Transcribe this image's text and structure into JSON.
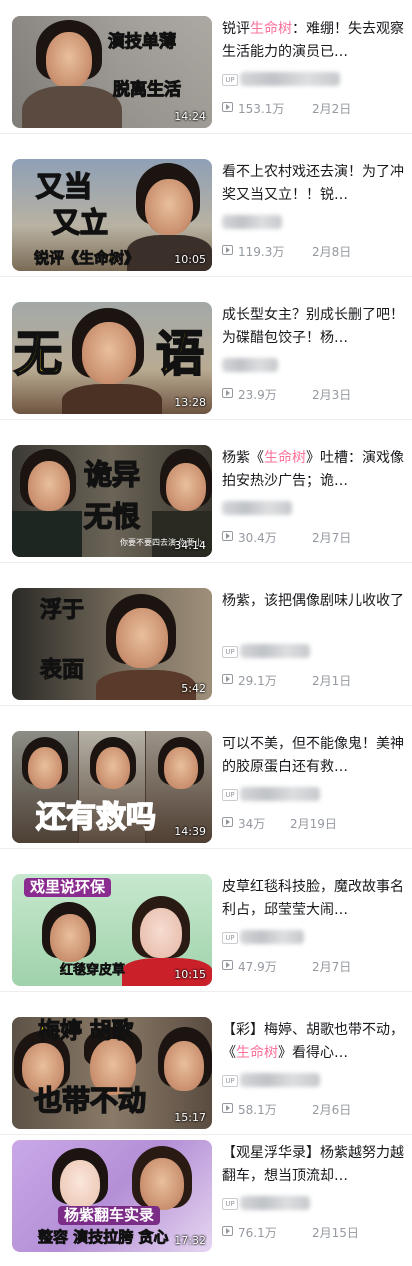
{
  "videos": [
    {
      "title": [
        "锐评",
        "生命树",
        "：难绷！失去观察生活能力的演员已…"
      ],
      "views": "153.1万",
      "date": "2月2日",
      "duration": "14:24",
      "captions": [
        "演技单薄",
        "脱离生活"
      ],
      "badge": "",
      "uploader_blurred": "锐评某某某某八事秀"
    },
    {
      "title": [
        "看不上农村戏还去演！为了冲奖又当又立！！锐…",
        "",
        ""
      ],
      "views": "119.3万",
      "date": "2月8日",
      "duration": "10:05",
      "captions": [
        "又当",
        "又立",
        "锐评《生命树》"
      ],
      "badge": "",
      "uploader_blurred": ""
    },
    {
      "title": [
        "成长型女主？别成长删了吧！为碟醋包饺子！杨…",
        "",
        ""
      ],
      "views": "23.9万",
      "date": "2月3日",
      "duration": "13:28",
      "captions": [
        "无",
        "语"
      ],
      "badge": "",
      "uploader_blurred": ""
    },
    {
      "title": [
        "杨紫《",
        "生命树",
        "》吐槽：演戏像拍安热沙广告；诡…"
      ],
      "views": "30.4万",
      "date": "2月7日",
      "duration": "34:14",
      "captions": [
        "诡异",
        "无恨",
        "你要不要四去演 你要小"
      ],
      "badge": "",
      "uploader_blurred": ""
    },
    {
      "title": [
        "杨紫，该把偶像剧味儿收收了",
        "",
        ""
      ],
      "views": "29.1万",
      "date": "2月1日",
      "duration": "5:42",
      "captions": [
        "浮于",
        "表面"
      ],
      "badge": "UP",
      "uploader_blurred": ""
    },
    {
      "title": [
        "可以不美，但不能像鬼！美神的胶原蛋白还有救…",
        "",
        ""
      ],
      "views": "34万",
      "date": "2月19日",
      "duration": "14:39",
      "captions": [
        "还有救吗"
      ],
      "badge": "UP",
      "uploader_blurred": ""
    },
    {
      "title": [
        "皮草红毯科技脸，魔改故事名利占，邱莹莹大闹…",
        "",
        ""
      ],
      "views": "47.9万",
      "date": "2月7日",
      "duration": "10:15",
      "captions": [
        "戏里说环保",
        "红毯穿皮草"
      ],
      "badge": "UP",
      "uploader_blurred": ""
    },
    {
      "title": [
        "【彩】梅婷、胡歌也带不动，《",
        "生命树",
        "》看得心…"
      ],
      "views": "58.1万",
      "date": "2月6日",
      "duration": "15:17",
      "captions": [
        "梅婷 胡歌",
        "也带不动"
      ],
      "badge": "UP",
      "uploader_blurred": ""
    },
    {
      "title": [
        "【观星浮华录】杨紫越努力越翻车，想当顶流却…",
        "",
        ""
      ],
      "views": "76.1万",
      "date": "2月15日",
      "duration": "17:32",
      "captions": [
        "杨紫翻车实录",
        "整容 演技拉胯 贪心"
      ],
      "badge": "UP",
      "uploader_blurred": ""
    }
  ]
}
